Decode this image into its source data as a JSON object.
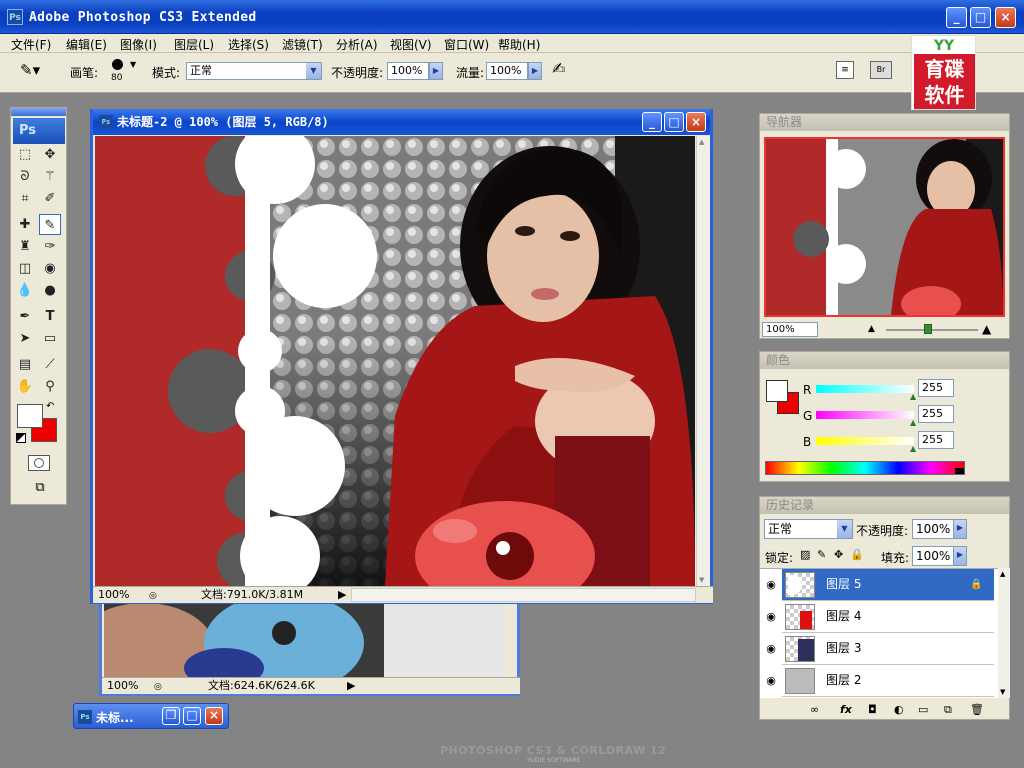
{
  "app": {
    "title": "Adobe Photoshop CS3 Extended",
    "icon_text": "Ps"
  },
  "menu": [
    "文件(F)",
    "编辑(E)",
    "图像(I)",
    "图层(L)",
    "选择(S)",
    "滤镜(T)",
    "分析(A)",
    "视图(V)",
    "窗口(W)",
    "帮助(H)"
  ],
  "options": {
    "brush_label": "画笔:",
    "brush_size": "80",
    "mode_label": "模式:",
    "mode_value": "正常",
    "opacity_label": "不透明度:",
    "opacity_value": "100%",
    "flow_label": "流量:",
    "flow_value": "100%"
  },
  "logo": {
    "top": "YY",
    "line1": "育碟",
    "line2": "软件"
  },
  "toolbox": {
    "logo": "Ps"
  },
  "doc_main": {
    "title": "未标题-2 @ 100% (图层 5, RGB/8)",
    "zoom": "100%",
    "doc_info": "文档:791.0K/3.81M"
  },
  "doc_back": {
    "zoom": "100%",
    "doc_info": "文档:624.6K/624.6K"
  },
  "minimized": {
    "title": "未标..."
  },
  "navigator": {
    "tab": "导航器",
    "zoom": "100%"
  },
  "color": {
    "tab": "颜色",
    "channels": [
      {
        "name": "R",
        "value": "255"
      },
      {
        "name": "G",
        "value": "255"
      },
      {
        "name": "B",
        "value": "255"
      }
    ]
  },
  "history": {
    "tab": "历史记录"
  },
  "layers": {
    "blend_mode": "正常",
    "opacity_label": "不透明度:",
    "opacity_value": "100%",
    "lock_label": "锁定:",
    "fill_label": "填充:",
    "fill_value": "100%",
    "items": [
      {
        "name": "图层 5",
        "selected": true
      },
      {
        "name": "图层 4",
        "selected": false
      },
      {
        "name": "图层 3",
        "selected": false
      },
      {
        "name": "图层 2",
        "selected": false
      }
    ]
  },
  "footer": {
    "brand": "PHOTOSHOP CS3 & CORLDRAW 12",
    "sub": "YUDIE SOFTWARE"
  },
  "colors": {
    "accent_blue": "#0a45c9",
    "canvas_red": "#b02a2a",
    "selection_blue": "#316ac5"
  }
}
